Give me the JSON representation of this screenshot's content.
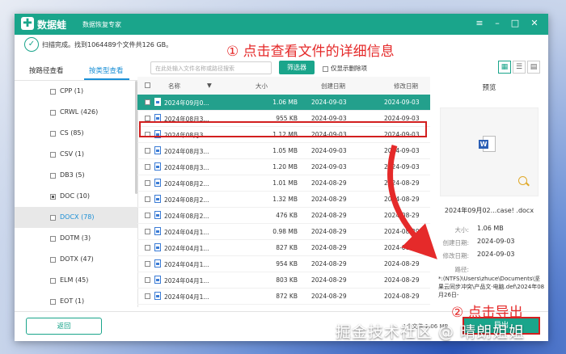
{
  "app": {
    "name": "数据蛙",
    "subtitle": "数据恢复专家",
    "scan_status": "扫描完成。找到1064489个文件共126 GB。"
  },
  "annotations": {
    "step1": "① 点击查看文件的详细信息",
    "step2": "② 点击导出",
    "watermark": "掘金技术社区 @ 晴朗姐姐"
  },
  "tabs": [
    {
      "label": "按路径查看",
      "active": false
    },
    {
      "label": "按类型查看",
      "active": true
    }
  ],
  "toolbar": {
    "search_placeholder": "在此处输入文件名称或路径搜索",
    "filter_label": "筛选器",
    "show_deleted_label": "仅显示删除项"
  },
  "sidebar": {
    "items": [
      {
        "label": "CPP (1)",
        "selected": false,
        "check": "none"
      },
      {
        "label": "CRWL (426)",
        "selected": false,
        "check": "none"
      },
      {
        "label": "CS (85)",
        "selected": false,
        "check": "none"
      },
      {
        "label": "CSV (1)",
        "selected": false,
        "check": "none"
      },
      {
        "label": "DB3 (5)",
        "selected": false,
        "check": "none"
      },
      {
        "label": "DOC (10)",
        "selected": false,
        "check": "partial"
      },
      {
        "label": "DOCX (78)",
        "selected": true,
        "check": "none"
      },
      {
        "label": "DOTM (3)",
        "selected": false,
        "check": "none"
      },
      {
        "label": "DOTX (47)",
        "selected": false,
        "check": "none"
      },
      {
        "label": "ELM (45)",
        "selected": false,
        "check": "none"
      },
      {
        "label": "EOT (1)",
        "selected": false,
        "check": "none"
      }
    ]
  },
  "table": {
    "columns": [
      "名称",
      "大小",
      "创建日期",
      "修改日期"
    ],
    "rows": [
      {
        "name": "2024年09月0...",
        "size": "1.06 MB",
        "created": "2024-09-03",
        "modified": "2024-09-03",
        "selected": true
      },
      {
        "name": "2024年08月3...",
        "size": "955 KB",
        "created": "2024-09-03",
        "modified": "2024-09-03",
        "selected": false
      },
      {
        "name": "2024年08月3...",
        "size": "1.12 MB",
        "created": "2024-09-03",
        "modified": "2024-09-03",
        "selected": false
      },
      {
        "name": "2024年08月3...",
        "size": "1.05 MB",
        "created": "2024-09-03",
        "modified": "2024-09-03",
        "selected": false
      },
      {
        "name": "2024年08月3...",
        "size": "1.20 MB",
        "created": "2024-09-03",
        "modified": "2024-09-03",
        "selected": false
      },
      {
        "name": "2024年08月2...",
        "size": "1.01 MB",
        "created": "2024-08-29",
        "modified": "2024-08-29",
        "selected": false
      },
      {
        "name": "2024年08月2...",
        "size": "1.32 MB",
        "created": "2024-08-29",
        "modified": "2024-08-29",
        "selected": false
      },
      {
        "name": "2024年08月2...",
        "size": "476 KB",
        "created": "2024-08-29",
        "modified": "2024-08-29",
        "selected": false
      },
      {
        "name": "2024年04月1...",
        "size": "0.98 MB",
        "created": "2024-08-29",
        "modified": "2024-08-29",
        "selected": false
      },
      {
        "name": "2024年04月1...",
        "size": "827 KB",
        "created": "2024-08-29",
        "modified": "2024-08-29",
        "selected": false
      },
      {
        "name": "2024年04月1...",
        "size": "954 KB",
        "created": "2024-08-29",
        "modified": "2024-08-29",
        "selected": false
      },
      {
        "name": "2024年04月1...",
        "size": "803 KB",
        "created": "2024-08-29",
        "modified": "2024-08-29",
        "selected": false
      },
      {
        "name": "2024年04月1...",
        "size": "872 KB",
        "created": "2024-08-29",
        "modified": "2024-08-29",
        "selected": false
      }
    ]
  },
  "preview": {
    "title": "预览",
    "filename": "2024年09月02...case! .docx",
    "size_label": "大小:",
    "size_value": "1.06 MB",
    "created_label": "创建日期:",
    "created_value": "2024-09-03",
    "modified_label": "修改日期:",
    "modified_value": "2024-09-03",
    "path_label": "路径:",
    "path_value": "*:(NTFS)\\Users\\zhuce\\Documents\\坚果云同步冲突\\产品文·电脑.def\\2024年08月26日-"
  },
  "footer": {
    "back_label": "返回",
    "selected_info": "1个文件 1.06 MB",
    "export_label": "导出"
  },
  "colors": {
    "brand_green": "#1aa58b",
    "accent_blue": "#1a8fd6",
    "annotation_red": "#e52a2a"
  }
}
